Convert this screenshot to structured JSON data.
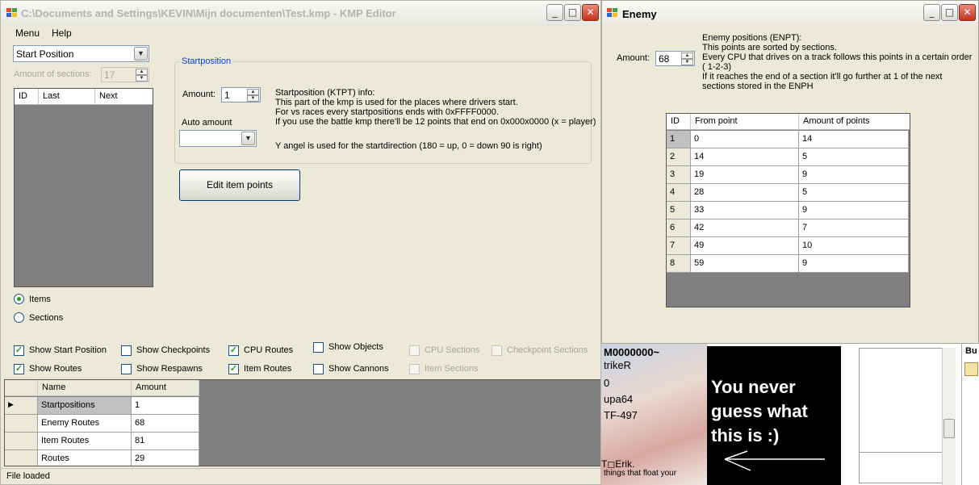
{
  "main": {
    "title": "C:\\Documents and Settings\\KEVIN\\Mijn documenten\\Test.kmp - KMP Editor",
    "menu": [
      "Menu",
      "Help"
    ],
    "section_select": "Start Position",
    "amount_sections_label": "Amount of sections:",
    "amount_sections_value": "17",
    "sections_columns": [
      "ID",
      "Last",
      "Next"
    ],
    "radio_items": "Items",
    "radio_sections": "Sections",
    "group_title": "Startposition",
    "amount_label": "Amount:",
    "amount_value": "1",
    "auto_amount_label": "Auto amount",
    "auto_amount_value": "",
    "info_lines": [
      "Startposition (KTPT) info:",
      "This part of the kmp is used for the places where drivers start.",
      "For vs races every startpositions ends with 0xFFFF0000.",
      "If you use the battle kmp there'll be 12 points that end on 0x000x0000 (x = player)",
      "",
      "Y angel is used for the startdirection (180 = up, 0 = down 90 is right)"
    ],
    "edit_button": "Edit item points",
    "checkboxes": [
      {
        "label": "Show Start Position",
        "checked": true,
        "enabled": true
      },
      {
        "label": "Show Checkpoints",
        "checked": false,
        "enabled": true
      },
      {
        "label": "CPU Routes",
        "checked": true,
        "enabled": true
      },
      {
        "label": "Show Objects",
        "checked": false,
        "enabled": true
      },
      {
        "label": "CPU Sections",
        "checked": false,
        "enabled": false
      },
      {
        "label": "Checkpoint Sections",
        "checked": false,
        "enabled": false
      },
      {
        "label": "Show Routes",
        "checked": true,
        "enabled": true
      },
      {
        "label": "Show Respawns",
        "checked": false,
        "enabled": true
      },
      {
        "label": "Item Routes",
        "checked": true,
        "enabled": true
      },
      {
        "label": "Show Cannons",
        "checked": false,
        "enabled": true
      },
      {
        "label": "Item Sections",
        "checked": false,
        "enabled": false
      }
    ],
    "summary_columns": [
      "Name",
      "Amount"
    ],
    "summary_rows": [
      {
        "name": "Startpositions",
        "amount": "1"
      },
      {
        "name": "Enemy Routes",
        "amount": "68"
      },
      {
        "name": "Item Routes",
        "amount": "81"
      },
      {
        "name": "Routes",
        "amount": "29"
      }
    ],
    "status": "File loaded"
  },
  "enemy": {
    "title": "Enemy",
    "amount_label": "Amount:",
    "amount_value": "68",
    "info_lines": [
      "Enemy positions (ENPT):",
      "This points are sorted by sections.",
      "Every CPU that drives on a track follows this points in a certain order",
      "( 1-2-3)",
      "If it reaches the end of a section it'll go further at 1 of the next",
      "sections stored in the ENPH"
    ],
    "columns": [
      "ID",
      "From point",
      "Amount of points"
    ],
    "rows": [
      {
        "id": "1",
        "from": "0",
        "amount": "14"
      },
      {
        "id": "2",
        "from": "14",
        "amount": "5"
      },
      {
        "id": "3",
        "from": "19",
        "amount": "9"
      },
      {
        "id": "4",
        "from": "28",
        "amount": "5"
      },
      {
        "id": "5",
        "from": "33",
        "amount": "9"
      },
      {
        "id": "6",
        "from": "42",
        "amount": "7"
      },
      {
        "id": "7",
        "from": "49",
        "amount": "10"
      },
      {
        "id": "8",
        "from": "59",
        "amount": "9"
      }
    ]
  },
  "background": {
    "names": [
      "M0000000~",
      "trikeR",
      "0",
      "upa64",
      "TF-497",
      "T◻Erik.",
      "things that float your"
    ],
    "caption": "You never guess what this is :)",
    "side_label": "Bu"
  },
  "colors": {
    "accent": "#0046d5",
    "window_bg": "#ece9d8",
    "grid_bg": "#808080",
    "check": "#21a121"
  }
}
